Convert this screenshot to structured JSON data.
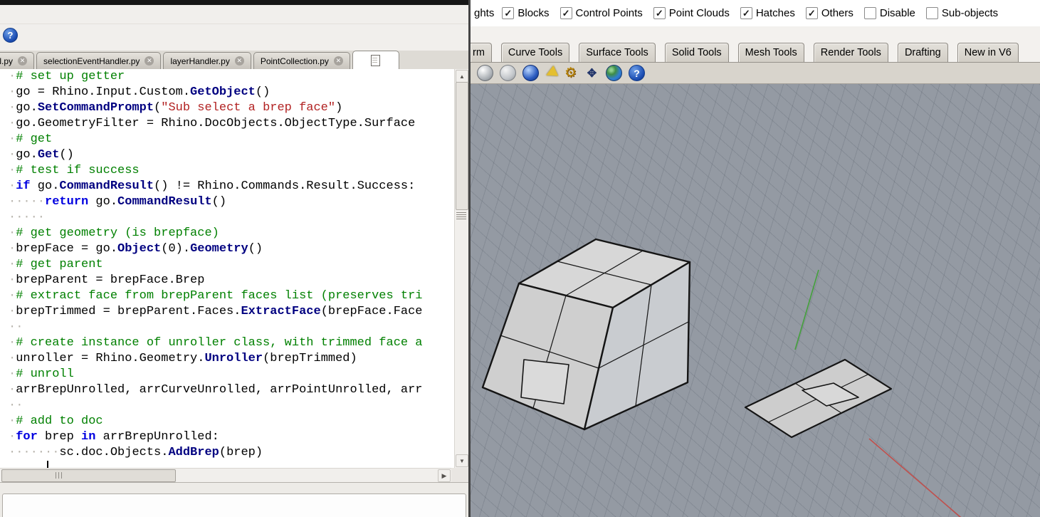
{
  "editor": {
    "help_icon": "?",
    "tabs": [
      {
        "label": "roll.py"
      },
      {
        "label": "selectionEventHandler.py"
      },
      {
        "label": "layerHandler.py"
      },
      {
        "label": "PointCollection.py"
      }
    ],
    "code": [
      [
        [
          "ws",
          "·"
        ],
        [
          "c",
          "# set up getter"
        ]
      ],
      [
        [
          "ws",
          "·"
        ],
        [
          "p",
          "go = Rhino.Input.Custom."
        ],
        [
          "m",
          "GetObject"
        ],
        [
          "p",
          "()"
        ]
      ],
      [
        [
          "ws",
          "·"
        ],
        [
          "p",
          "go."
        ],
        [
          "m",
          "SetCommandPrompt"
        ],
        [
          "p",
          "("
        ],
        [
          "s",
          "\"Sub select a brep face\""
        ],
        [
          "p",
          ")"
        ]
      ],
      [
        [
          "ws",
          "·"
        ],
        [
          "p",
          "go.GeometryFilter = Rhino.DocObjects.ObjectType.Surface"
        ]
      ],
      [
        [
          "ws",
          "·"
        ],
        [
          "c",
          "# get"
        ]
      ],
      [
        [
          "ws",
          "·"
        ],
        [
          "p",
          "go."
        ],
        [
          "m",
          "Get"
        ],
        [
          "p",
          "()"
        ]
      ],
      [
        [
          "ws",
          "·"
        ],
        [
          "c",
          "# test if success"
        ]
      ],
      [
        [
          "ws",
          "·"
        ],
        [
          "k",
          "if"
        ],
        [
          "p",
          " go."
        ],
        [
          "m",
          "CommandResult"
        ],
        [
          "p",
          "() != Rhino.Commands.Result.Success:"
        ]
      ],
      [
        [
          "ws",
          "·····"
        ],
        [
          "k",
          "return"
        ],
        [
          "p",
          " go."
        ],
        [
          "m",
          "CommandResult"
        ],
        [
          "p",
          "()"
        ]
      ],
      [
        [
          "ws",
          "·····"
        ]
      ],
      [
        [
          "ws",
          "·"
        ],
        [
          "c",
          "# get geometry (is brepface)"
        ]
      ],
      [
        [
          "ws",
          "·"
        ],
        [
          "p",
          "brepFace = go."
        ],
        [
          "m",
          "Object"
        ],
        [
          "p",
          "(0)."
        ],
        [
          "m",
          "Geometry"
        ],
        [
          "p",
          "()"
        ]
      ],
      [
        [
          "ws",
          "·"
        ],
        [
          "c",
          "# get parent"
        ]
      ],
      [
        [
          "ws",
          "·"
        ],
        [
          "p",
          "brepParent = brepFace.Brep"
        ]
      ],
      [
        [
          "ws",
          "·"
        ],
        [
          "c",
          "# extract face from brepParent faces list (preserves tri"
        ]
      ],
      [
        [
          "ws",
          "·"
        ],
        [
          "p",
          "brepTrimmed = brepParent.Faces."
        ],
        [
          "m",
          "ExtractFace"
        ],
        [
          "p",
          "(brepFace.Face"
        ]
      ],
      [
        [
          "ws",
          "··"
        ]
      ],
      [
        [
          "ws",
          "·"
        ],
        [
          "c",
          "# create instance of unroller class, with trimmed face a"
        ]
      ],
      [
        [
          "ws",
          "·"
        ],
        [
          "p",
          "unroller = Rhino.Geometry."
        ],
        [
          "m",
          "Unroller"
        ],
        [
          "p",
          "(brepTrimmed)"
        ]
      ],
      [
        [
          "ws",
          "·"
        ],
        [
          "c",
          "# unroll"
        ]
      ],
      [
        [
          "ws",
          "·"
        ],
        [
          "p",
          "arrBrepUnrolled, arrCurveUnrolled, arrPointUnrolled, arr"
        ]
      ],
      [
        [
          "ws",
          "··"
        ]
      ],
      [
        [
          "ws",
          "·"
        ],
        [
          "c",
          "# add to doc"
        ]
      ],
      [
        [
          "ws",
          "·"
        ],
        [
          "k",
          "for"
        ],
        [
          "p",
          " brep "
        ],
        [
          "k",
          "in"
        ],
        [
          "p",
          " arrBrepUnrolled:"
        ]
      ],
      [
        [
          "ws",
          "·······"
        ],
        [
          "p",
          "sc.doc.Objects."
        ],
        [
          "m",
          "AddBrep"
        ],
        [
          "p",
          "(brep)"
        ]
      ]
    ]
  },
  "rhino": {
    "filter_bar": {
      "leading_partial": "ghts",
      "items": [
        {
          "label": "Blocks",
          "checked": true
        },
        {
          "label": "Control Points",
          "checked": true
        },
        {
          "label": "Point Clouds",
          "checked": true
        },
        {
          "label": "Hatches",
          "checked": true
        },
        {
          "label": "Others",
          "checked": true
        },
        {
          "label": "Disable",
          "checked": false
        },
        {
          "label": "Sub-objects",
          "checked": false
        }
      ]
    },
    "tab_bar": {
      "partial_tab": "rm",
      "tabs": [
        "Curve Tools",
        "Surface Tools",
        "Solid Tools",
        "Mesh Tools",
        "Render Tools",
        "Drafting",
        "New in V6"
      ]
    },
    "toolbar": {
      "icons": [
        {
          "name": "shaded-sphere-icon",
          "kind": "sphere-light"
        },
        {
          "name": "ghosted-sphere-icon",
          "kind": "sphere-ghost"
        },
        {
          "name": "rendered-sphere-icon",
          "kind": "sphere-blue"
        },
        {
          "name": "cone-icon",
          "kind": "cone"
        },
        {
          "name": "gear-icon",
          "kind": "gear"
        },
        {
          "name": "gumball-icon",
          "kind": "gumball"
        },
        {
          "name": "earth-globe-icon",
          "kind": "earth"
        },
        {
          "name": "help-icon",
          "kind": "help"
        }
      ]
    },
    "viewport": {
      "bg": "#949aa3",
      "face_top": "#d7d7d7",
      "face_left": "#cfcfcf",
      "face_right": "#c9ccd0",
      "subface": "#dadada",
      "sheet": "#cdcdcd",
      "hole": "#d8d8d8",
      "edge": "#141414",
      "axis_green": "#44a03c",
      "axis_red": "#c0504d"
    }
  }
}
